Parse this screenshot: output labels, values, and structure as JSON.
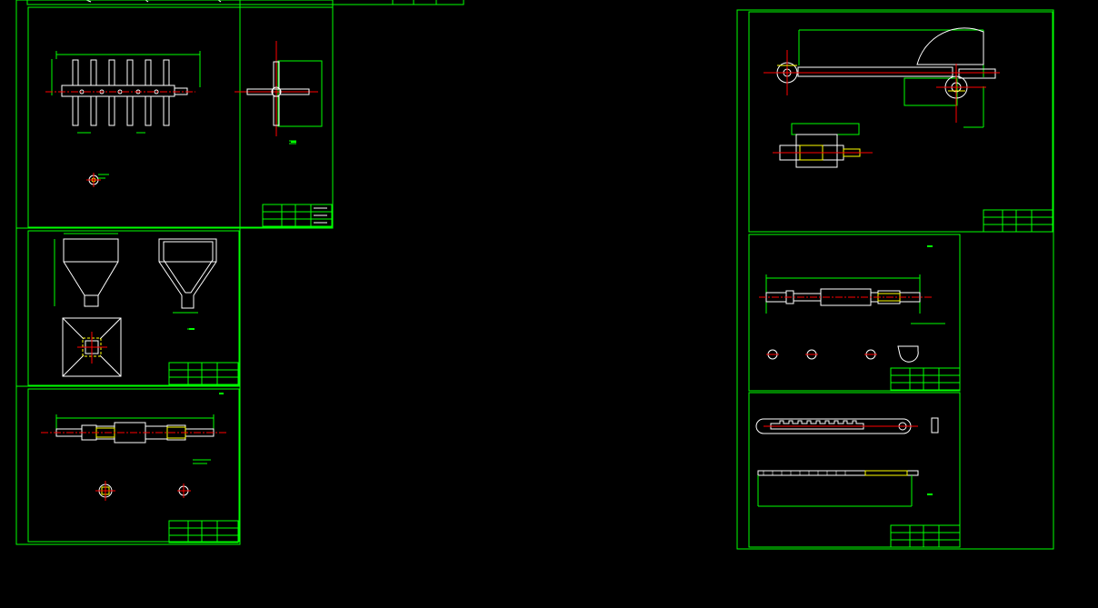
{
  "app": {
    "name": "",
    "background": "#000000"
  },
  "colors": {
    "frame": "#00ff00",
    "geometry": "#ffffff",
    "centerline": "#ff0000",
    "dimension": "#00ff00",
    "hatch": "#ffff00",
    "highlight": "#00ffff"
  },
  "drawings": [
    {
      "id": "top-left-partial",
      "label": ""
    },
    {
      "id": "agitator-shaft-assembly",
      "label": ""
    },
    {
      "id": "hopper",
      "label": ""
    },
    {
      "id": "stepped-shaft",
      "label": ""
    },
    {
      "id": "crank-arm-assembly",
      "label": ""
    },
    {
      "id": "long-shaft",
      "label": ""
    },
    {
      "id": "toothed-rack",
      "label": ""
    }
  ]
}
